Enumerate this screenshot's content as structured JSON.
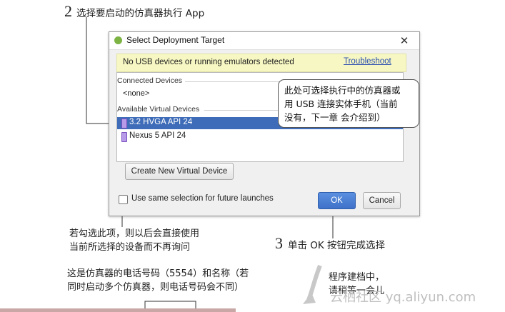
{
  "annotations": {
    "step2_number": "2",
    "step2_text": "选择要启动的仿真器执行 App",
    "step3_number": "3",
    "step3_text": "单击 OK 按钮完成选择",
    "callout_line1": "此处可选择执行中的仿真器或",
    "callout_line2": "用 USB 连接实体手机（当前",
    "callout_line3": "没有，下一章 会介绍到）",
    "checkbox_note_line1": "若勾选此项，则以后会直接使用",
    "checkbox_note_line2": "当前所选择的设备而不再询问",
    "phone_note_line1": "这是仿真器的电话号码（5554）和名称（若",
    "phone_note_line2": "同时启动多个仿真器，则电话号码会不同）",
    "progress_note_line1": "程序建档中，",
    "progress_note_line2": "请稍等一会儿",
    "watermark": "云栖社区 yq.aliyun.com"
  },
  "dialog": {
    "title": "Select Deployment Target",
    "close_glyph": "✕",
    "warning_text": "No USB devices or running emulators detected",
    "troubleshoot_link": "Troubleshoot",
    "connected_label": "Connected Devices",
    "connected_none": "<none>",
    "available_label": "Available Virtual Devices",
    "devices": [
      {
        "name": "3.2  HVGA API 24",
        "selected": true
      },
      {
        "name": "Nexus 5 API 24",
        "selected": false
      }
    ],
    "create_button": "Create New Virtual Device",
    "checkbox_label": "Use same selection for future launches",
    "checkbox_checked": false,
    "ok_button": "OK",
    "cancel_button": "Cancel"
  },
  "colors": {
    "selection": "#3e6cb8",
    "warning_bg": "#f7f7c3",
    "link": "#2a4fb0",
    "ok_button": "#4a7fd4"
  }
}
